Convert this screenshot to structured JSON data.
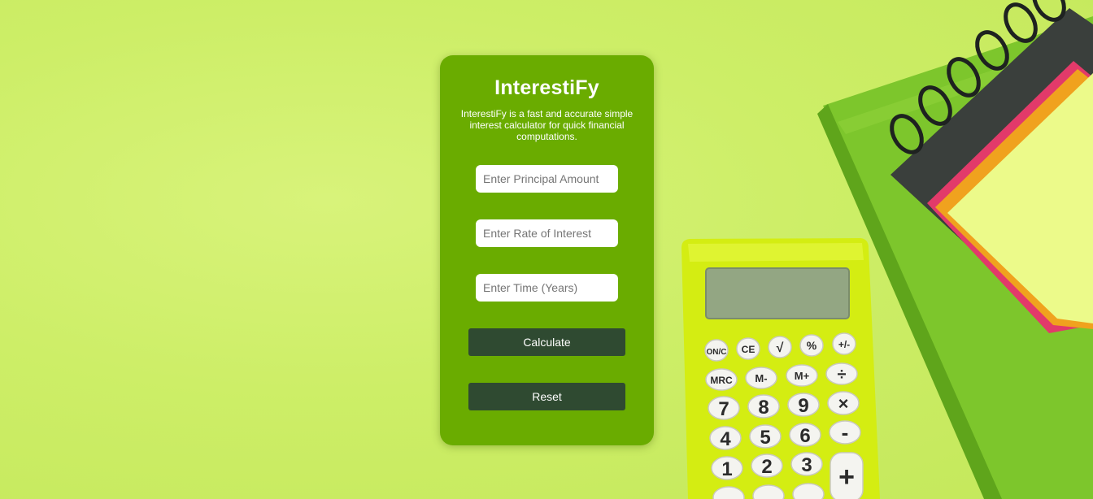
{
  "app": {
    "title": "InterestiFy",
    "description": "InterestiFy is a fast and accurate simple interest calculator for quick financial computations."
  },
  "form": {
    "principal_placeholder": "Enter Principal Amount",
    "rate_placeholder": "Enter Rate of Interest",
    "time_placeholder": "Enter Time (Years)",
    "principal_value": "",
    "rate_value": "",
    "time_value": ""
  },
  "buttons": {
    "calculate_label": "Calculate",
    "reset_label": "Reset"
  },
  "background": {
    "calculator_keys": [
      "ON/C",
      "CE",
      "√",
      "%",
      "+/-",
      "MRC",
      "M-",
      "M+",
      "÷",
      "7",
      "8",
      "9",
      "×",
      "4",
      "5",
      "6",
      "-",
      "1",
      "2",
      "3",
      "+"
    ]
  },
  "colors": {
    "background": "#cdee67",
    "card": "#6aac00",
    "button": "#2f4a31",
    "button_text": "#ffffff",
    "calculator_body": "#d9ef1a",
    "notebook_cover": "#7cc52b"
  }
}
